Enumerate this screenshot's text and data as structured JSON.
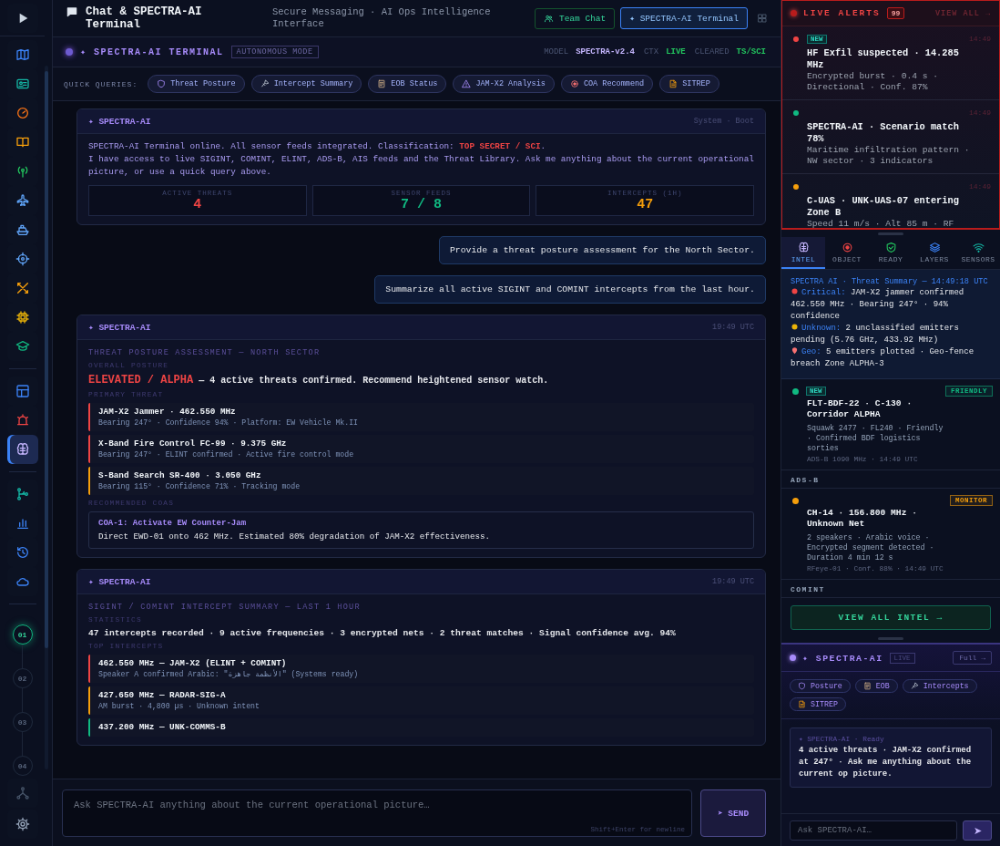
{
  "rail": {
    "groups": [
      {
        "items": [
          {
            "kind": "play",
            "selected": false
          }
        ]
      },
      {
        "items": [
          {
            "kind": "map",
            "selected": false
          },
          {
            "kind": "idcard",
            "selected": false
          },
          {
            "kind": "gauge",
            "selected": false
          },
          {
            "kind": "book",
            "selected": false
          },
          {
            "kind": "antenna",
            "selected": false
          },
          {
            "kind": "plane",
            "selected": false
          },
          {
            "kind": "ship",
            "selected": false
          },
          {
            "kind": "crosshair",
            "selected": false
          },
          {
            "kind": "tools",
            "selected": false
          },
          {
            "kind": "chip",
            "selected": false
          },
          {
            "kind": "cap",
            "selected": false
          }
        ]
      },
      {
        "items": [
          {
            "kind": "dashboard",
            "selected": false
          },
          {
            "kind": "alarm",
            "selected": false
          },
          {
            "kind": "brain",
            "selected": true
          }
        ]
      },
      {
        "items": [
          {
            "kind": "branch",
            "selected": false
          },
          {
            "kind": "bars",
            "selected": false
          },
          {
            "kind": "history",
            "selected": false
          },
          {
            "kind": "cloud",
            "selected": false
          }
        ]
      }
    ],
    "steps": [
      {
        "label": "01",
        "selected": true
      },
      {
        "label": "02",
        "selected": false
      },
      {
        "label": "03",
        "selected": false
      },
      {
        "label": "04",
        "selected": false
      }
    ],
    "footer": [
      {
        "kind": "network",
        "selected": false
      },
      {
        "kind": "gear",
        "selected": false
      }
    ]
  },
  "header": {
    "title": "Chat & SPECTRA-AI Terminal",
    "subtitle": "Secure Messaging · AI Ops Intelligence Interface",
    "modes": [
      {
        "label": "Team Chat",
        "kind": "team",
        "selected": false
      },
      {
        "label": "✦ SPECTRA-AI Terminal",
        "kind": "ai",
        "selected": true
      }
    ]
  },
  "terminal": {
    "title": "✦ SPECTRA-AI TERMINAL",
    "mode": "AUTONOMOUS MODE",
    "meta": [
      {
        "label": "MODEL",
        "value": "SPECTRA-v2.4",
        "color": "#c4b5fd"
      },
      {
        "label": "CTX",
        "value": "LIVE",
        "color": "#22c55e"
      },
      {
        "label": "CLEARED",
        "value": "TS/SCI",
        "color": "#22c55e"
      }
    ]
  },
  "quick_queries": {
    "label": "QUICK QUERIES:",
    "items": [
      {
        "label": "Threat Posture",
        "kind": "shield"
      },
      {
        "label": "Intercept Summary",
        "kind": "brush"
      },
      {
        "label": "EOB Status",
        "kind": "ledger"
      },
      {
        "label": "JAM-X2 Analysis",
        "kind": "warning"
      },
      {
        "label": "COA Recommend",
        "kind": "target"
      },
      {
        "label": "SITREP",
        "kind": "doc"
      }
    ]
  },
  "messages": [
    {
      "kind": "ai",
      "sender": "✦ SPECTRA-AI",
      "time": "System · Boot",
      "blocks": [
        {
          "kind": "text",
          "text": "SPECTRA-AI Terminal online. All sensor feeds integrated. Classification: **TOP SECRET / SCI**.\nI have access to live SIGINT, COMINT, ELINT, ADS-B, AIS feeds and the Threat Library. Ask me anything about the current operational picture, or use a quick query above."
        },
        {
          "kind": "stats",
          "items": [
            {
              "label": "ACTIVE THREATS",
              "value": "4",
              "color": "#ef4444"
            },
            {
              "label": "SENSOR FEEDS",
              "value": "7 / 8",
              "color": "#10b981"
            },
            {
              "label": "INTERCEPTS (1H)",
              "value": "47",
              "color": "#f59e0b"
            }
          ]
        }
      ]
    },
    {
      "kind": "user",
      "text": "Provide a threat posture assessment for the North Sector."
    },
    {
      "kind": "user",
      "text": "Summarize all active SIGINT and COMINT intercepts from the last hour."
    },
    {
      "kind": "ai",
      "sender": "✦ SPECTRA-AI",
      "time": "19:49 UTC",
      "blocks": [
        {
          "kind": "heading",
          "text": "THREAT POSTURE ASSESSMENT — NORTH SECTOR"
        },
        {
          "kind": "label",
          "text": "OVERALL POSTURE"
        },
        {
          "kind": "lead",
          "text": "**ELEVATED / ALPHA** — 4 active threats confirmed. Recommend heightened sensor watch."
        },
        {
          "kind": "label",
          "text": "PRIMARY THREAT"
        },
        {
          "kind": "entries",
          "items": [
            {
              "title": "JAM-X2 Jammer · 462.550 MHz",
              "detail": "Bearing 247° · Confidence 94% · Platform: EW Vehicle Mk.II",
              "color": "#ef4444"
            },
            {
              "title": "X-Band Fire Control FC-99 · 9.375 GHz",
              "detail": "Bearing 247° · ELINT confirmed · Active fire control mode",
              "color": "#ef4444"
            },
            {
              "title": "S-Band Search SR-400 · 3.050 GHz",
              "detail": "Bearing 115° · Confidence 71% · Tracking mode",
              "color": "#f59e0b"
            }
          ]
        },
        {
          "kind": "label",
          "text": "RECOMMENDED COAS"
        },
        {
          "kind": "coa",
          "title": "COA-1: Activate EW Counter-Jam",
          "text": "Direct EWD-01 onto 462 MHz. Estimated 80% degradation of JAM-X2 effectiveness."
        }
      ]
    },
    {
      "kind": "ai",
      "sender": "✦ SPECTRA-AI",
      "time": "19:49 UTC",
      "blocks": [
        {
          "kind": "heading",
          "text": "SIGINT / COMINT INTERCEPT SUMMARY — LAST 1 HOUR"
        },
        {
          "kind": "label",
          "text": "STATISTICS"
        },
        {
          "kind": "plain",
          "text": "47 intercepts recorded · 9 active frequencies · 3 encrypted nets · 2 threat matches · Signal confidence avg. 94%"
        },
        {
          "kind": "label",
          "text": "TOP INTERCEPTS"
        },
        {
          "kind": "entries",
          "items": [
            {
              "title": "462.550 MHz — JAM-X2 (ELINT + COMINT)",
              "detail": "Speaker A confirmed Arabic: \"الأنظمة جاهزة\" (Systems ready)",
              "color": "#ef4444"
            },
            {
              "title": "427.650 MHz — RADAR-SIG-A",
              "detail": "AM burst · 4,800 µs · Unknown intent",
              "color": "#f59e0b"
            },
            {
              "title": "437.200 MHz — UNK-COMMS-B",
              "color": "#10b981"
            }
          ]
        }
      ]
    }
  ],
  "composer": {
    "placeholder": "Ask SPECTRA-AI anything about the current operational picture…",
    "hint": "Shift+Enter for newline",
    "send": "➤ SEND"
  },
  "alerts": {
    "title": "LIVE ALERTS",
    "count": "99",
    "action": "VIEW ALL →",
    "items": [
      {
        "color": "#ef4444",
        "badge": "NEW",
        "time": "14:49",
        "title": "HF Exfil suspected · 14.285 MHz",
        "detail": "Encrypted burst · 0.4 s · Directional · Conf. 87%"
      },
      {
        "color": "#10b981",
        "time": "14:49",
        "title": "SPECTRA-AI · Scenario match 78%",
        "detail": "Maritime infiltration pattern · NW sector · 3 indicators"
      },
      {
        "color": "#f59e0b",
        "time": "14:49",
        "title": "C-UAS · UNK-UAS-07 entering Zone B",
        "detail": "Speed 11 m/s · Alt 85 m · RF"
      }
    ]
  },
  "intel": {
    "tabs": [
      {
        "label": "INTEL",
        "kind": "brain",
        "selected": true
      },
      {
        "label": "OBJECT",
        "kind": "target",
        "selected": false
      },
      {
        "label": "READY",
        "kind": "shieldcheck",
        "selected": false
      },
      {
        "label": "LAYERS",
        "kind": "layers",
        "selected": false
      },
      {
        "label": "SENSORS",
        "kind": "wifi",
        "selected": false
      }
    ],
    "summary": {
      "title": "SPECTRA AI · Threat Summary — 14:49:18 UTC",
      "lines": [
        {
          "kind": "critical",
          "label": "Critical:",
          "text": "JAM-X2 jammer confirmed 462.550 MHz · Bearing 247° · 94% confidence"
        },
        {
          "kind": "unknown",
          "label": "Unknown:",
          "text": "2 unclassified emitters pending (5.76 GHz, 433.92 MHz)"
        },
        {
          "kind": "geo",
          "label": "Geo:",
          "text": "5 emitters plotted · Geo-fence breach Zone ALPHA-3"
        }
      ]
    },
    "feed": [
      {
        "kind": "item",
        "color": "#10b981",
        "badge": "NEW",
        "tag": "FRIENDLY",
        "title": "FLT-BDF-22 · C-130 · Corridor ALPHA",
        "detail": "Squawk 2477 · FL240 · Friendly · Confirmed BDF logistics sorties",
        "source": "ADS-B 1090 MHz · 14:49 UTC"
      },
      {
        "kind": "section",
        "label": "ADS-B"
      },
      {
        "kind": "item",
        "color": "#f59e0b",
        "tag": "MONITOR",
        "title": "CH-14 · 156.800 MHz · Unknown Net",
        "detail": "2 speakers · Arabic voice · Encrypted segment detected · Duration 4 min 12 s",
        "source": "RFeye-01 · Conf. 88% · 14:49 UTC"
      },
      {
        "kind": "section",
        "label": "COMINT"
      }
    ],
    "view_all": "VIEW ALL INTEL →"
  },
  "mini_ai": {
    "title": "✦ SPECTRA-AI",
    "status": "LIVE",
    "action": "Full →",
    "chips": [
      {
        "label": "Posture",
        "kind": "shield"
      },
      {
        "label": "EOB",
        "kind": "ledger"
      },
      {
        "label": "Intercepts",
        "kind": "brush"
      },
      {
        "label": "SITREP",
        "kind": "doc"
      }
    ],
    "message": {
      "meta": "✦ SPECTRA-AI · Ready",
      "text": "4 active threats · JAM-X2 confirmed at 247° · Ask me anything about the current op picture."
    },
    "placeholder": "Ask SPECTRA-AI…",
    "send": "➤"
  }
}
